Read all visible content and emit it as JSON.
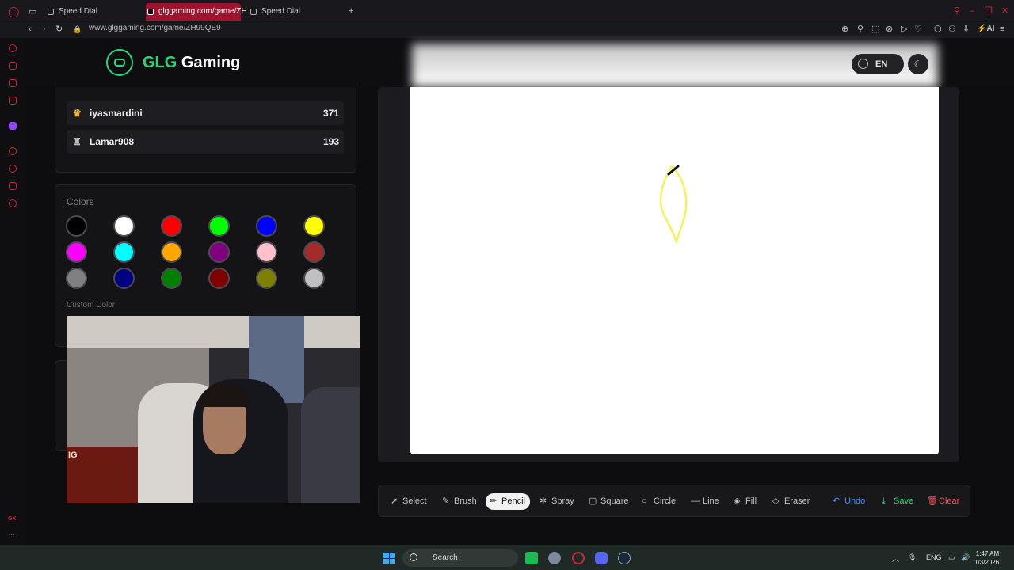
{
  "browser": {
    "tabs": [
      {
        "label": "Speed Dial",
        "active": false
      },
      {
        "label": "glggaming.com/game/ZH",
        "active": true
      },
      {
        "label": "Speed Dial",
        "active": false
      }
    ],
    "url": "www.glggaming.com/game/ZH99QE9",
    "ai_label": "AI",
    "gx_label": "GX"
  },
  "header": {
    "logo_prefix": "GLG",
    "logo_suffix": " Gaming",
    "language": "EN"
  },
  "leaderboard": [
    {
      "name": "iyasmardini",
      "score": "371",
      "icon": "crown-icon"
    },
    {
      "name": "Lamar908",
      "score": "193",
      "icon": "trophy-icon"
    }
  ],
  "colors": {
    "title": "Colors",
    "custom_label": "Custom Color",
    "palette": [
      "#000000",
      "#ffffff",
      "#ff0000",
      "#00ff00",
      "#0000ff",
      "#ffff00",
      "#ff00ff",
      "#00ffff",
      "#ffa500",
      "#800080",
      "#ffc0cb",
      "#a52a2a",
      "#808080",
      "#000080",
      "#008000",
      "#800000",
      "#808000",
      "#c0c0c0"
    ]
  },
  "webcam": {
    "overlay_text": "IG"
  },
  "toolbar": {
    "select": "Select",
    "brush": "Brush",
    "pencil": "Pencil",
    "spray": "Spray",
    "square": "Square",
    "circle": "Circle",
    "line": "Line",
    "fill": "Fill",
    "eraser": "Eraser",
    "undo": "Undo",
    "save": "Save",
    "clear": "Clear",
    "active_tool": "pencil"
  },
  "taskbar": {
    "search": "Search",
    "lang": "ENG",
    "time": "1:47 AM",
    "date": "1/3/2026"
  }
}
